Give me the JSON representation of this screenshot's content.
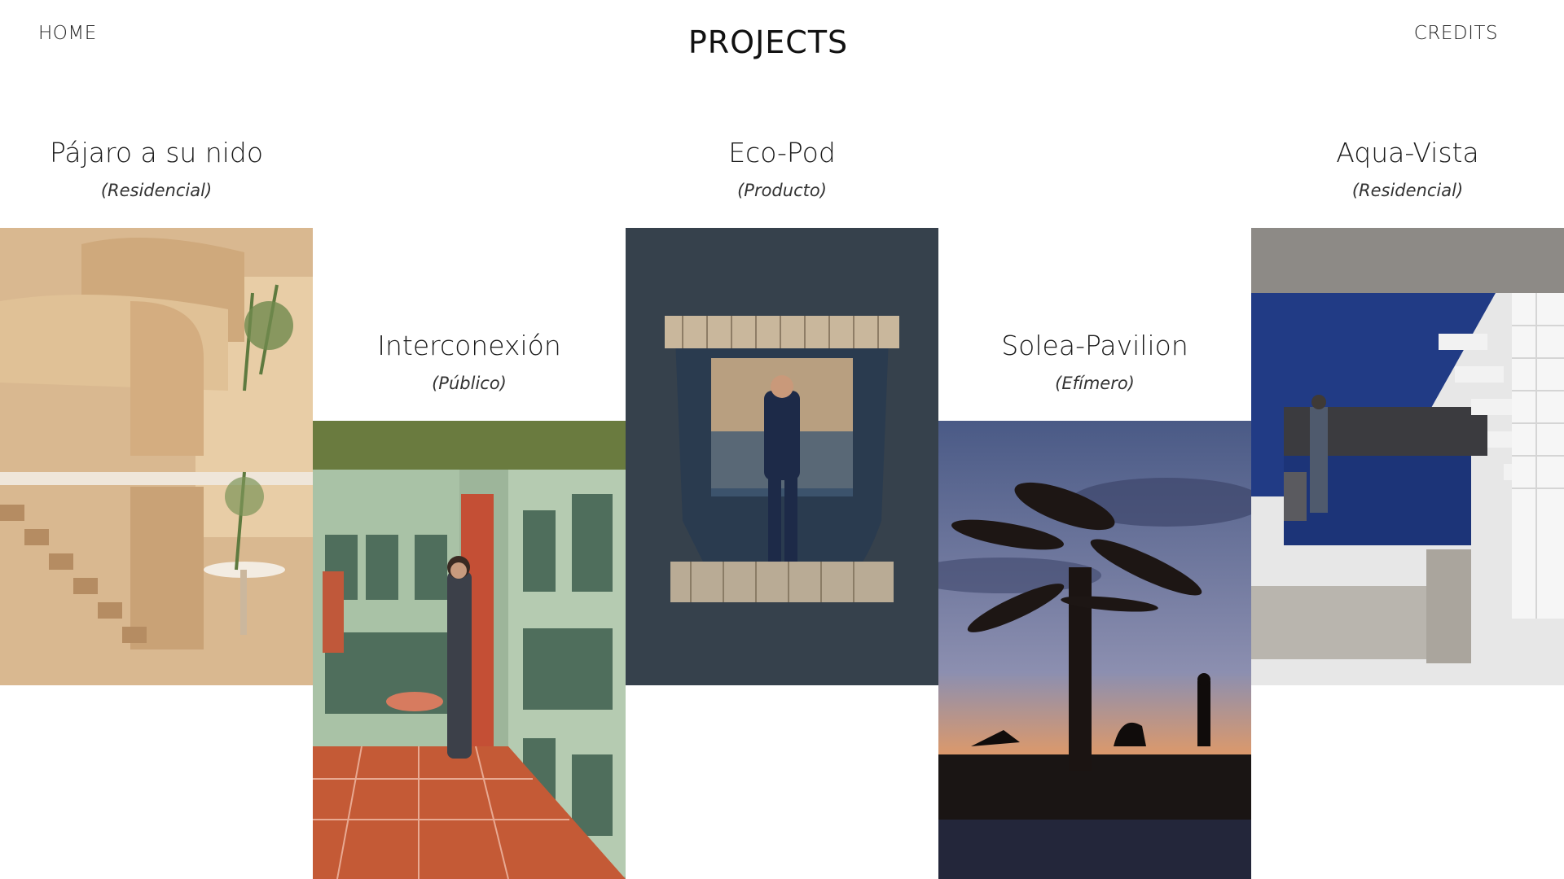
{
  "nav": {
    "home_label": "HOME",
    "credits_label": "CREDITS"
  },
  "page": {
    "title": "PROJECTS"
  },
  "projects": [
    {
      "title": "Pájaro a su nido",
      "category": "(Residencial)",
      "image_icon": "sculpted-house-render"
    },
    {
      "title": "Interconexión",
      "category": "(Público)",
      "image_icon": "wine-cellar-render"
    },
    {
      "title": "Eco-Pod",
      "category": "(Producto)",
      "image_icon": "pod-seat-render"
    },
    {
      "title": "Solea-Pavilion",
      "category": "(Efímero)",
      "image_icon": "sunset-pavilion-render"
    },
    {
      "title": "Aqua-Vista",
      "category": "(Residencial)",
      "image_icon": "blue-kitchen-stair-render"
    }
  ]
}
